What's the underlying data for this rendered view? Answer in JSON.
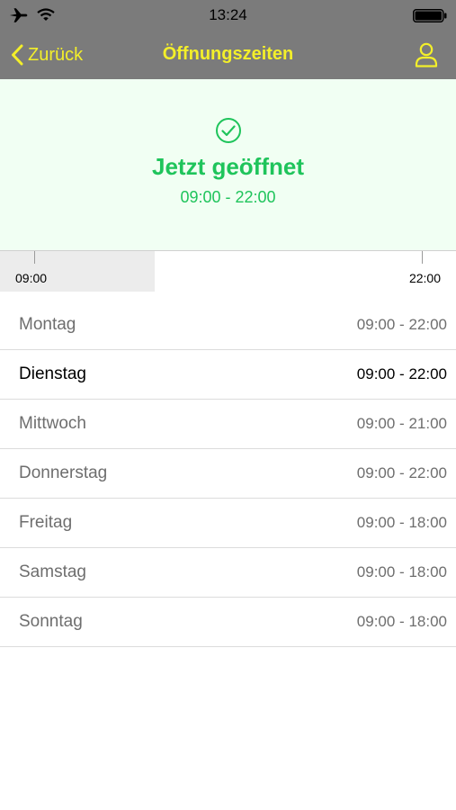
{
  "status_bar": {
    "time": "13:24",
    "icons": [
      "airplane-icon",
      "wifi-icon",
      "battery-icon"
    ]
  },
  "nav": {
    "back_label": "Zurück",
    "back_icon": "chevron-left-icon",
    "title": "Öffnungszeiten",
    "profile_icon": "person-icon"
  },
  "status": {
    "icon": "checkmark-circle-icon",
    "heading": "Jetzt geöffnet",
    "hours": "09:00 - 22:00"
  },
  "timeline": {
    "start_label": "09:00",
    "end_label": "22:00",
    "elapsed_fraction": 0.34
  },
  "days": [
    {
      "name": "Montag",
      "hours": "09:00 - 22:00",
      "today": false
    },
    {
      "name": "Dienstag",
      "hours": "09:00 - 22:00",
      "today": true
    },
    {
      "name": "Mittwoch",
      "hours": "09:00 - 21:00",
      "today": false
    },
    {
      "name": "Donnerstag",
      "hours": "09:00 - 22:00",
      "today": false
    },
    {
      "name": "Freitag",
      "hours": "09:00 - 18:00",
      "today": false
    },
    {
      "name": "Samstag",
      "hours": "09:00 - 18:00",
      "today": false
    },
    {
      "name": "Sonntag",
      "hours": "09:00 - 18:00",
      "today": false
    }
  ],
  "colors": {
    "header_bg": "#7b7b7b",
    "accent_yellow": "#f3ef2a",
    "open_green": "#1fc45b",
    "banner_bg": "#f1fff3"
  }
}
